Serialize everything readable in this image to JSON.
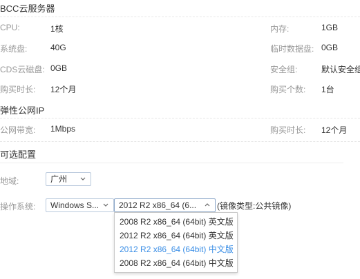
{
  "server": {
    "title": "BCC云服务器",
    "cpu_label": "CPU:",
    "cpu_value": "1核",
    "memory_label": "内存:",
    "memory_value": "1GB",
    "system_disk_label": "系统盘:",
    "system_disk_value": "40G",
    "temp_disk_label": "临时数据盘:",
    "temp_disk_value": "0GB",
    "cds_label": "CDS云磁盘:",
    "cds_value": "0GB",
    "security_group_label": "安全组:",
    "security_group_value": "默认安全组",
    "duration_label": "购买时长:",
    "duration_value": "12个月",
    "count_label": "购买个数:",
    "count_value": "1台"
  },
  "eip": {
    "title": "弹性公网IP",
    "bandwidth_label": "公网带宽:",
    "bandwidth_value": "1Mbps",
    "duration_label": "购买时长:",
    "duration_value": "12个月"
  },
  "optional": {
    "title": "可选配置",
    "region_label": "地域:",
    "region_value": "广州",
    "os_label": "操作系统:",
    "os_value": "Windows S...",
    "image_value": "2012 R2 x86_64 (6...",
    "image_type_text": "(镜像类型:公共镜像)",
    "image_options": [
      {
        "label": "2008 R2 x86_64 (64bit) 英文版",
        "selected": false
      },
      {
        "label": "2012 R2 x86_64 (64bit) 英文版",
        "selected": false
      },
      {
        "label": "2012 R2 x86_64 (64bit) 中文版",
        "selected": true
      },
      {
        "label": "2008 R2 x86_64 (64bit) 中文版",
        "selected": false
      }
    ]
  },
  "colors": {
    "label": "#999999",
    "text": "#333333",
    "selected_option": "#3a8ee6",
    "select_border": "#b8c8dc"
  }
}
